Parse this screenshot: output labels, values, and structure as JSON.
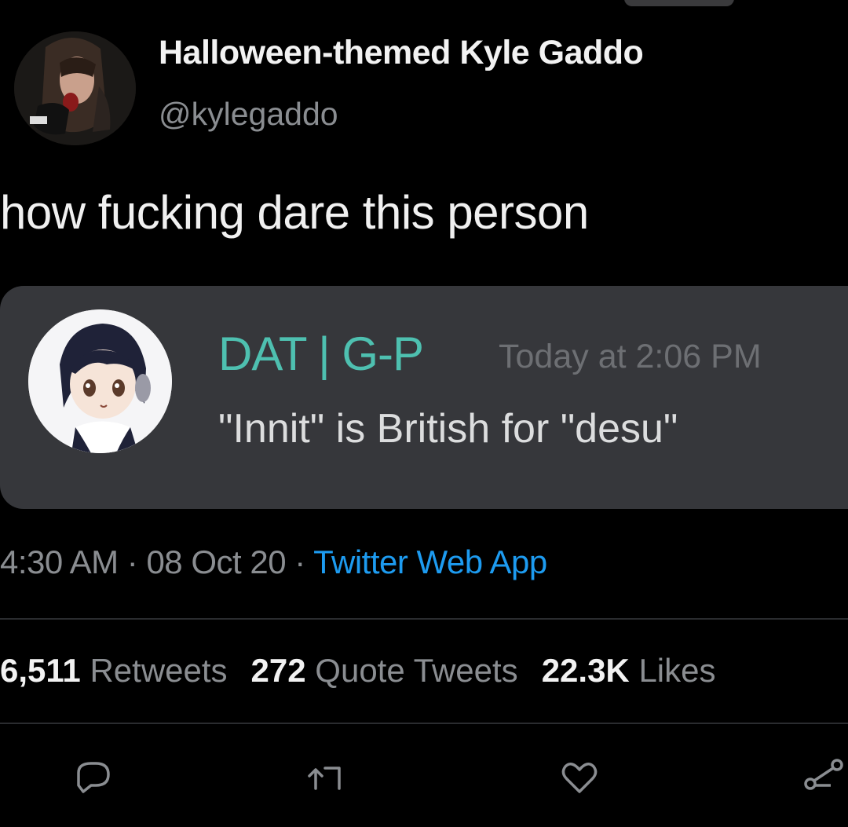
{
  "user": {
    "display_name": "Halloween-themed Kyle Gaddo",
    "handle": "@kylegaddo"
  },
  "tweet": {
    "text": "how fucking dare this person"
  },
  "embed": {
    "username": "DAT | G-P",
    "timestamp": "Today at 2:06 PM",
    "message": "\"Innit\" is British for \"desu\""
  },
  "meta": {
    "time": "4:30 AM",
    "separator": "·",
    "date": "08 Oct 20",
    "source": "Twitter Web App"
  },
  "stats": {
    "retweets_count": "6,511",
    "retweets_label": "Retweets",
    "quote_count": "272",
    "quote_label": "Quote Tweets",
    "likes_count": "22.3K",
    "likes_label": "Likes"
  },
  "icons": {
    "reply": "reply-icon",
    "retweet": "retweet-icon",
    "like": "heart-icon",
    "share": "share-icon"
  },
  "colors": {
    "background": "#000000",
    "embed_background": "#36373b",
    "embed_username": "#4ec0b0",
    "link": "#1d9bf0",
    "muted": "#8a8d91"
  }
}
